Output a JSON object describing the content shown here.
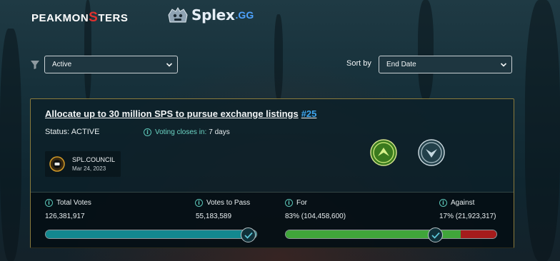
{
  "brand": {
    "peakmonsters_before": "PEAKMON",
    "peakmonsters_accent": "S",
    "peakmonsters_after": "TERS",
    "splex_word": "Splex",
    "splex_tld": ".GG"
  },
  "filters": {
    "status_selected": "Active",
    "sort_label": "Sort by",
    "sort_selected": "End Date"
  },
  "proposal": {
    "title": "Allocate up to 30 million SPS to pursue exchange listings",
    "number": "#25",
    "status": "Status: ACTIVE",
    "voting_label": "Voting closes in:",
    "voting_value": "7 days",
    "author_name": "SPL.COUNCIL",
    "author_date": "Mar 24, 2023",
    "total_votes_label": "Total Votes",
    "total_votes_value": "126,381,917",
    "votes_to_pass_label": "Votes to Pass",
    "votes_to_pass_value": "55,183,589",
    "for_label": "For",
    "for_value": "83% (104,458,600)",
    "against_label": "Against",
    "against_value": "17% (21,923,317)",
    "for_fraction": 0.83,
    "against_fraction": 0.17,
    "votes_progress_fraction": 1.0
  },
  "colors": {
    "accent_blue": "#3ea6f0",
    "for_green": "#40a53a",
    "against_red": "#a51c1c",
    "card_border": "#8a7a3c"
  }
}
